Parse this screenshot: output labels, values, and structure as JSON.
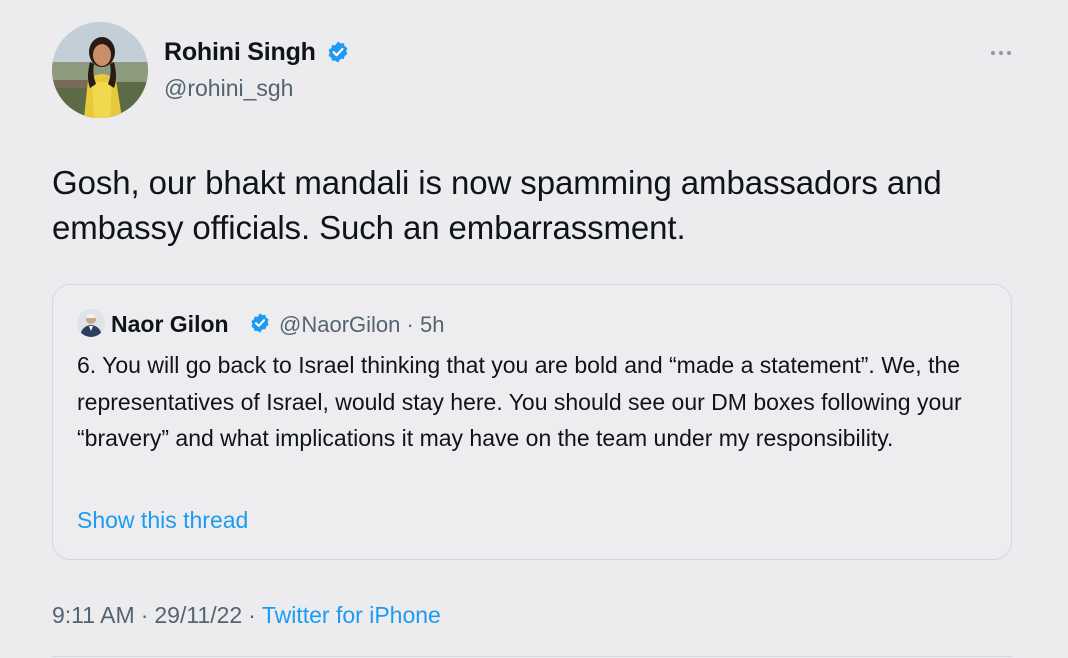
{
  "author": {
    "name": "Rohini Singh",
    "handle": "@rohini_sgh",
    "verified": true
  },
  "tweet": {
    "text": "Gosh, our bhakt mandali is now spamming ambassadors and embassy officials. Such an embarrassment."
  },
  "quoted": {
    "name": "Naor Gilon",
    "handle": "@NaorGilon",
    "dot": "·",
    "time": "5h",
    "text": "6. You will go back to Israel thinking that you are bold and “made a statement”. We, the representatives of Israel, would stay here. You should see our DM boxes following your “bravery” and what implications it may have on the team under my responsibility.",
    "show_thread": "Show this thread"
  },
  "footer": {
    "time": "9:11 AM",
    "sep1": "·",
    "date": "29/11/22",
    "sep2": "·",
    "source": "Twitter for iPhone"
  },
  "colors": {
    "background": "#ececef",
    "link": "#1d9bf0",
    "secondary_text": "#536471",
    "verified": "#1d9bf0"
  },
  "icons": {
    "verified": "verified-badge-icon",
    "more": "more-dots-icon"
  }
}
